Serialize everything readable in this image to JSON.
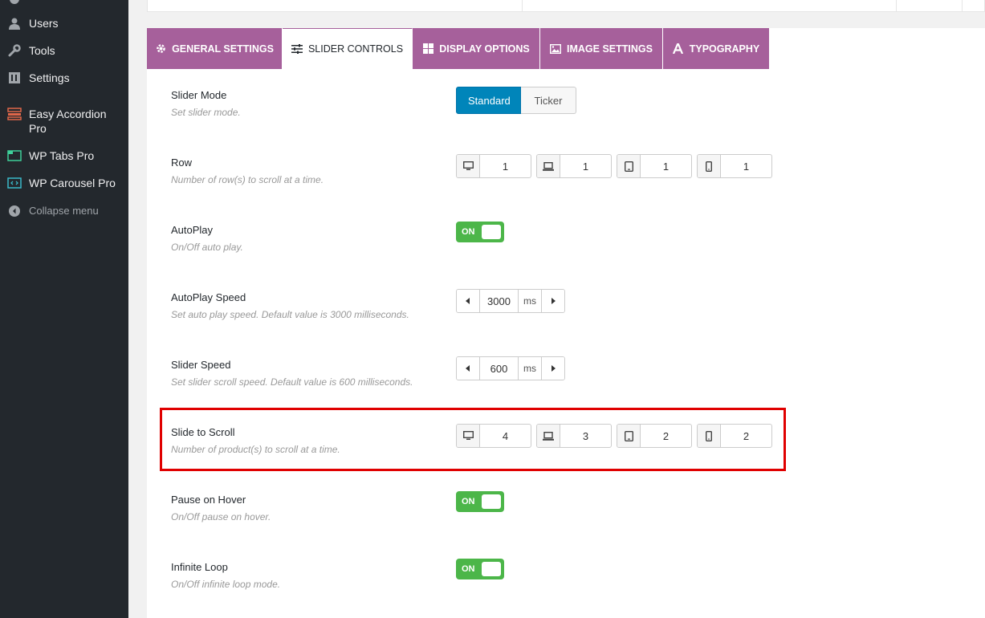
{
  "sidebar": {
    "items": [
      {
        "label": "Users",
        "icon": "users-icon"
      },
      {
        "label": "Tools",
        "icon": "tools-icon"
      },
      {
        "label": "Settings",
        "icon": "settings-icon"
      },
      {
        "label": "Easy Accordion Pro",
        "icon": "accordion-icon"
      },
      {
        "label": "WP Tabs Pro",
        "icon": "tabs-icon"
      },
      {
        "label": "WP Carousel Pro",
        "icon": "carousel-icon"
      }
    ],
    "collapse": "Collapse menu"
  },
  "tabs": [
    {
      "label": "GENERAL SETTINGS",
      "icon": "gear-icon"
    },
    {
      "label": "SLIDER CONTROLS",
      "icon": "sliders-icon",
      "active": true
    },
    {
      "label": "DISPLAY OPTIONS",
      "icon": "grid-icon"
    },
    {
      "label": "IMAGE SETTINGS",
      "icon": "image-icon"
    },
    {
      "label": "TYPOGRAPHY",
      "icon": "font-icon"
    }
  ],
  "fields": {
    "slider_mode": {
      "title": "Slider Mode",
      "desc": "Set slider mode.",
      "options": [
        "Standard",
        "Ticker"
      ],
      "selected": "Standard"
    },
    "row": {
      "title": "Row",
      "desc": "Number of row(s) to scroll at a time.",
      "values": [
        "1",
        "1",
        "1",
        "1"
      ]
    },
    "autoplay": {
      "title": "AutoPlay",
      "desc": "On/Off auto play.",
      "state": "ON"
    },
    "autoplay_speed": {
      "title": "AutoPlay Speed",
      "desc": "Set auto play speed. Default value is 3000 milliseconds.",
      "value": "3000",
      "unit": "ms"
    },
    "slider_speed": {
      "title": "Slider Speed",
      "desc": "Set slider scroll speed. Default value is 600 milliseconds.",
      "value": "600",
      "unit": "ms"
    },
    "slide_to_scroll": {
      "title": "Slide to Scroll",
      "desc": "Number of product(s) to scroll at a time.",
      "values": [
        "4",
        "3",
        "2",
        "2"
      ]
    },
    "pause_on_hover": {
      "title": "Pause on Hover",
      "desc": "On/Off pause on hover.",
      "state": "ON"
    },
    "infinite_loop": {
      "title": "Infinite Loop",
      "desc": "On/Off infinite loop mode.",
      "state": "ON"
    }
  },
  "colors": {
    "tab_bg": "#a6609b",
    "toggle_on": "#4cb649",
    "primary": "#0085ba",
    "highlight": "#e00000"
  }
}
